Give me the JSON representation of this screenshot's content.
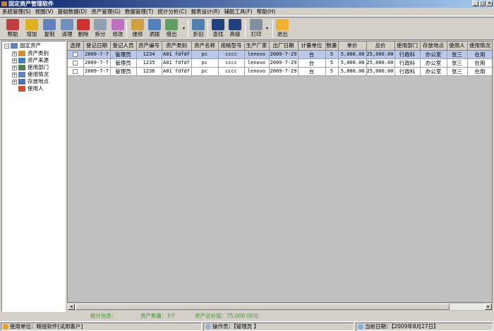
{
  "window": {
    "title": "固定资产管理软件",
    "buttons": [
      "_",
      "□",
      "×"
    ]
  },
  "menu": [
    "系统管理(S)",
    "视图(V)",
    "基础数据(D)",
    "资产管理(G)",
    "数据管理(T)",
    "统计分析(C)",
    "报表设计(R)",
    "辅助工具(F)",
    "帮助(H)"
  ],
  "toolbar": [
    {
      "label": "帮助",
      "icon": "help-icon",
      "color": "#c04040"
    },
    {
      "label": "增加",
      "icon": "add-icon",
      "color": "#e0b020"
    },
    {
      "label": "复制",
      "icon": "copy-icon",
      "color": "#6080c0"
    },
    {
      "label": "清理",
      "icon": "clear-icon",
      "color": "#7090c0"
    },
    {
      "label": "删除",
      "icon": "delete-icon",
      "color": "#d03030"
    },
    {
      "label": "拆分",
      "icon": "split-icon",
      "color": "#90a0b0"
    },
    {
      "label": "修改",
      "icon": "edit-icon",
      "color": "#c070c0"
    },
    {
      "label": "维修",
      "icon": "repair-icon",
      "color": "#d0a040"
    },
    {
      "label": "调拨",
      "icon": "transfer-icon",
      "color": "#5080c0"
    },
    {
      "label": "借出",
      "icon": "lend-icon",
      "color": "#60a060"
    },
    {
      "label": "折旧",
      "icon": "depreciation-icon",
      "color": "#5080b0"
    },
    {
      "label": "查找",
      "icon": "find-icon",
      "color": "#204080"
    },
    {
      "label": "高级",
      "icon": "advanced-find-icon",
      "color": "#204080"
    },
    {
      "label": "打印",
      "icon": "print-icon",
      "color": "#8090a0"
    },
    {
      "label": "退出",
      "icon": "exit-icon",
      "color": "#f0b030"
    }
  ],
  "tree": {
    "root": "固定资产",
    "children": [
      "资产类别",
      "资产来源",
      "使用部门",
      "使用情况",
      "存放地点",
      "使用人"
    ]
  },
  "grid": {
    "columns": [
      "选择",
      "登记日期",
      "登记人员",
      "资产编号",
      "资产类别",
      "资产名称",
      "规格型号",
      "生产厂家",
      "出厂日期",
      "计量单位",
      "数量",
      "单价",
      "总价",
      "使用部门",
      "存放地点",
      "使用人",
      "使用情况"
    ],
    "rows": [
      [
        "",
        "2009-7-7",
        "管理员",
        "1234",
        "A01 fdfdf",
        "pc",
        "cccc",
        "lenovo",
        "2009-7-29",
        "台",
        "5",
        "5,000.00",
        "25,000.00",
        "行政科",
        "办公室",
        "张三",
        "在用"
      ],
      [
        "",
        "2009-7-7",
        "管理员",
        "1235",
        "A01 fdfdf",
        "pc",
        "cccc",
        "lenovo",
        "2009-7-29",
        "台",
        "5",
        "5,000.00",
        "25,000.00",
        "行政科",
        "办公室",
        "张三",
        "在用"
      ],
      [
        "",
        "2009-7-7",
        "管理员",
        "1236",
        "A01 fdfdf",
        "pc",
        "cccc",
        "lenovo",
        "2009-7-29",
        "台",
        "5",
        "5,000.00",
        "25,000.00",
        "行政科",
        "办公室",
        "张三",
        "在用"
      ]
    ],
    "selected_row": 0
  },
  "stats": {
    "label": "统计信息：",
    "count": "资产数量：3个",
    "total": "资产总价值：75,000.00元"
  },
  "statusbar": {
    "unit": "使用单位：精锐软件[试用客户]",
    "operator": "操作员：【管理员 】",
    "date": "当前日期：【2009年8月27日】"
  }
}
